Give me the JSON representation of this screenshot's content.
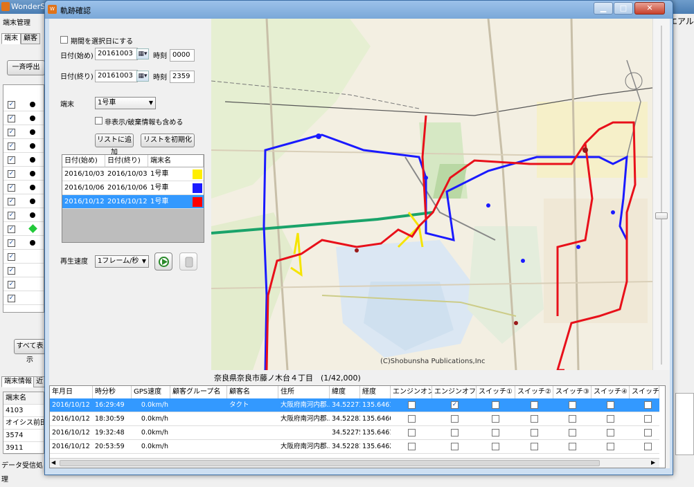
{
  "parent": {
    "title": "WonderSco",
    "menu_label": "端末管理",
    "help_fragment": "エアル",
    "tabs": [
      "端末",
      "顧客"
    ],
    "bulk_button": "一斉呼出",
    "show_all_button": "すべて表示",
    "bottom_tabs": [
      "端末情報",
      "近"
    ],
    "table_header": "端末名",
    "table_rows": [
      "4103",
      "オイシス前田氏",
      "3574",
      "3911"
    ],
    "status": "データ受信処理"
  },
  "dialog": {
    "title": "軌跡確認",
    "period_checkbox": "期間を選択日にする",
    "start_date_label": "日付(始め)",
    "start_date": "20161003",
    "start_time_label": "時刻",
    "start_time": "0000",
    "end_date_label": "日付(終り)",
    "end_date": "20161003",
    "end_time_label": "時刻",
    "end_time": "2359",
    "device_label": "端末",
    "device_value": "1号車",
    "hidden_checkbox": "非表示/破棄情報も含める",
    "add_list_button": "リストに追加",
    "reset_list_button": "リストを初期化",
    "history": {
      "headers": [
        "日付(始め)",
        "日付(終り)",
        "端末名"
      ],
      "rows": [
        {
          "start": "2016/10/03",
          "end": "2016/10/03",
          "name": "1号車",
          "color": "#ffee00"
        },
        {
          "start": "2016/10/06",
          "end": "2016/10/06",
          "name": "1号車",
          "color": "#1a1aff"
        },
        {
          "start": "2016/10/12",
          "end": "2016/10/12",
          "name": "1号車",
          "color": "#ff0000"
        }
      ]
    },
    "speed_label": "再生速度",
    "speed_value": "1フレーム/秒",
    "map_caption": "奈良県奈良市藤ノ木台４丁目　(1/42,000)",
    "map_copyright": "(C)Shobunsha Publications,Inc",
    "grid": {
      "headers": [
        "年月日",
        "時分秒",
        "GPS速度",
        "顧客グループ名",
        "顧客名",
        "住所",
        "緯度",
        "経度",
        "エンジンオン",
        "エンジンオフ",
        "スイッチ①",
        "スイッチ②",
        "スイッチ③",
        "スイッチ④",
        "スイッチ⑤"
      ],
      "rows": [
        {
          "date": "2016/10/12",
          "time": "16:29:49",
          "speed": "0.0km/h",
          "group": "",
          "customer": "タクト",
          "address": "大阪府南河内郡...",
          "lat": "34.52273...",
          "lon": "135.6461...",
          "engine_on": false,
          "engine_off": true
        },
        {
          "date": "2016/10/12",
          "time": "18:30:59",
          "speed": "0.0km/h",
          "group": "",
          "customer": "",
          "address": "大阪府南河内郡...",
          "lat": "34.52283...",
          "lon": "135.6460...",
          "engine_on": false,
          "engine_off": false
        },
        {
          "date": "2016/10/12",
          "time": "19:32:48",
          "speed": "0.0km/h",
          "group": "",
          "customer": "",
          "address": "",
          "lat": "34.52275...",
          "lon": "135.6461...",
          "engine_on": false,
          "engine_off": false
        },
        {
          "date": "2016/10/12",
          "time": "20:53:59",
          "speed": "0.0km/h",
          "group": "",
          "customer": "",
          "address": "大阪府南河内郡...",
          "lat": "34.52281...",
          "lon": "135.6462...",
          "engine_on": false,
          "engine_off": false
        }
      ]
    }
  },
  "colors": {
    "route_blue": "#1a1aff",
    "route_red": "#e8101a",
    "route_yellow": "#f5e400",
    "selection": "#3399ff"
  }
}
